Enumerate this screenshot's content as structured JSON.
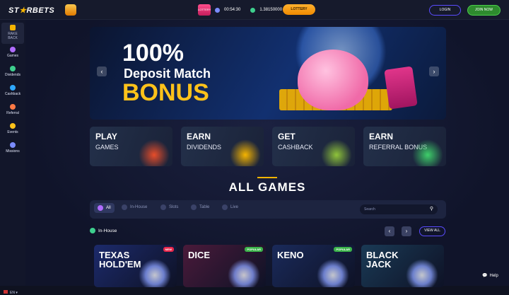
{
  "header": {
    "logo_pre": "ST",
    "logo_star": "★",
    "logo_post": "RBETS",
    "lottery_badge": "LOTTERY",
    "timer": "00:54:30",
    "balance": "1.38150000",
    "lottery_button": "LOTTERY",
    "login": "LOGIN",
    "join": "JOIN NOW"
  },
  "sidebar": {
    "rake_line1": "RAKE",
    "rake_line2": "BACK",
    "items": [
      {
        "label": "Games",
        "color": "#b06cff",
        "icon": "games-icon"
      },
      {
        "label": "Dividends",
        "color": "#3ecf8e",
        "icon": "dividends-icon"
      },
      {
        "label": "Cashback",
        "color": "#2fa8ff",
        "icon": "cashback-icon"
      },
      {
        "label": "Referral",
        "color": "#ff7a45",
        "icon": "referral-icon"
      },
      {
        "label": "Events",
        "color": "#ffc21a",
        "icon": "events-icon"
      },
      {
        "label": "Missions",
        "color": "#7b8cff",
        "icon": "missions-icon"
      }
    ],
    "language": "EN"
  },
  "hero": {
    "line1": "100%",
    "line2": "Deposit Match",
    "line3": "BONUS",
    "prev": "‹",
    "next": "›"
  },
  "promos": [
    {
      "title": "PLAY",
      "subtitle": "GAMES",
      "color": "#e84d2a"
    },
    {
      "title": "EARN",
      "subtitle": "DIVIDENDS",
      "color": "#f5b400"
    },
    {
      "title": "GET",
      "subtitle": "CASHBACK",
      "color": "#8fc43a"
    },
    {
      "title": "EARN",
      "subtitle": "REFERRAL BONUS",
      "color": "#3ecf6a"
    }
  ],
  "games": {
    "title": "ALL GAMES",
    "filters": {
      "all": "All",
      "inhouse": "In-House",
      "slots": "Slots",
      "table": "Table",
      "live": "Live"
    },
    "search_placeholder": "Search",
    "section": "In-House",
    "view_all": "VIEW ALL",
    "cards": [
      {
        "name1": "TEXAS",
        "name2": "HOLD'EM",
        "tag": "NEW",
        "tag_color": "#e8264a",
        "bg": "#1c2a6b"
      },
      {
        "name1": "DICE",
        "name2": "",
        "tag": "POPULAR",
        "tag_color": "#3bb34a",
        "bg": "#4a1a3a"
      },
      {
        "name1": "KENO",
        "name2": "",
        "tag": "POPULAR",
        "tag_color": "#3bb34a",
        "bg": "#1a2a5a"
      },
      {
        "name1": "BLACK",
        "name2": "JACK",
        "tag": "",
        "tag_color": "",
        "bg": "#1a3a55"
      }
    ]
  },
  "help": "Help"
}
